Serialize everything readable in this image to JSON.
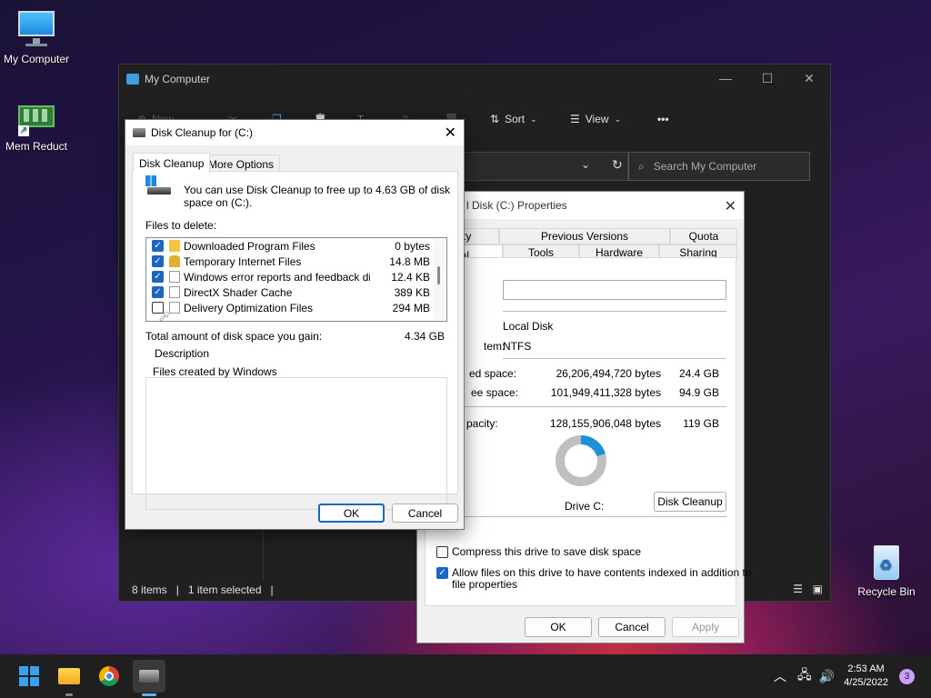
{
  "desktop": {
    "my_computer": "My Computer",
    "mem_reduct": "Mem Reduct",
    "recycle_bin": "Recycle Bin"
  },
  "explorer": {
    "title": "My Computer",
    "new_label": "New",
    "sort_label": "Sort",
    "view_label": "View",
    "more_label": "•••",
    "search_placeholder": "Search My Computer",
    "status_items": "8 items",
    "status_selected": "1 item selected"
  },
  "properties": {
    "title": "l Disk (C:) Properties",
    "tabs_row1": [
      "curity",
      "Previous Versions",
      "Quota"
    ],
    "tabs_row2": [
      "eral",
      "Tools",
      "Hardware",
      "Sharing"
    ],
    "type_value": "Local Disk",
    "fs_label": "tem:",
    "fs_value": "NTFS",
    "used_label": "ed space:",
    "used_bytes": "26,206,494,720 bytes",
    "used_gb": "24.4 GB",
    "free_label": "ee space:",
    "free_bytes": "101,949,411,328 bytes",
    "free_gb": "94.9 GB",
    "cap_label": "pacity:",
    "cap_bytes": "128,155,906,048 bytes",
    "cap_gb": "119 GB",
    "used_fraction": 0.2045,
    "drive_label": "Drive C:",
    "disk_cleanup_btn": "Disk Cleanup",
    "compress_label": "Compress this drive to save disk space",
    "index_label": "Allow files on this drive to have contents indexed in addition to",
    "index_label2": "file properties",
    "ok": "OK",
    "cancel": "Cancel",
    "apply": "Apply",
    "used_color": "#1e90d6",
    "free_color": "#bfbfbf"
  },
  "cleanup": {
    "title": "Disk Cleanup for  (C:)",
    "tab_cleanup": "Disk Cleanup",
    "tab_more": "More Options",
    "intro": "You can use Disk Cleanup to free up to 4.63 GB of disk",
    "intro2": "space on  (C:).",
    "files_label": "Files to delete:",
    "files": [
      {
        "name": "Downloaded Program Files",
        "size": "0 bytes",
        "checked": true
      },
      {
        "name": "Temporary Internet Files",
        "size": "14.8 MB",
        "checked": true
      },
      {
        "name": "Windows error reports and feedback di...",
        "size": "12.4 KB",
        "checked": true
      },
      {
        "name": "DirectX Shader Cache",
        "size": "389 KB",
        "checked": true
      },
      {
        "name": "Delivery Optimization Files",
        "size": "294 MB",
        "checked": false
      }
    ],
    "total_label": "Total amount of disk space you gain:",
    "total_value": "4.34 GB",
    "desc_label": "Description",
    "desc_text": "Files created by Windows",
    "ok": "OK",
    "cancel": "Cancel"
  },
  "taskbar": {
    "time": "2:53 AM",
    "date": "4/25/2022",
    "notif_count": "3"
  }
}
